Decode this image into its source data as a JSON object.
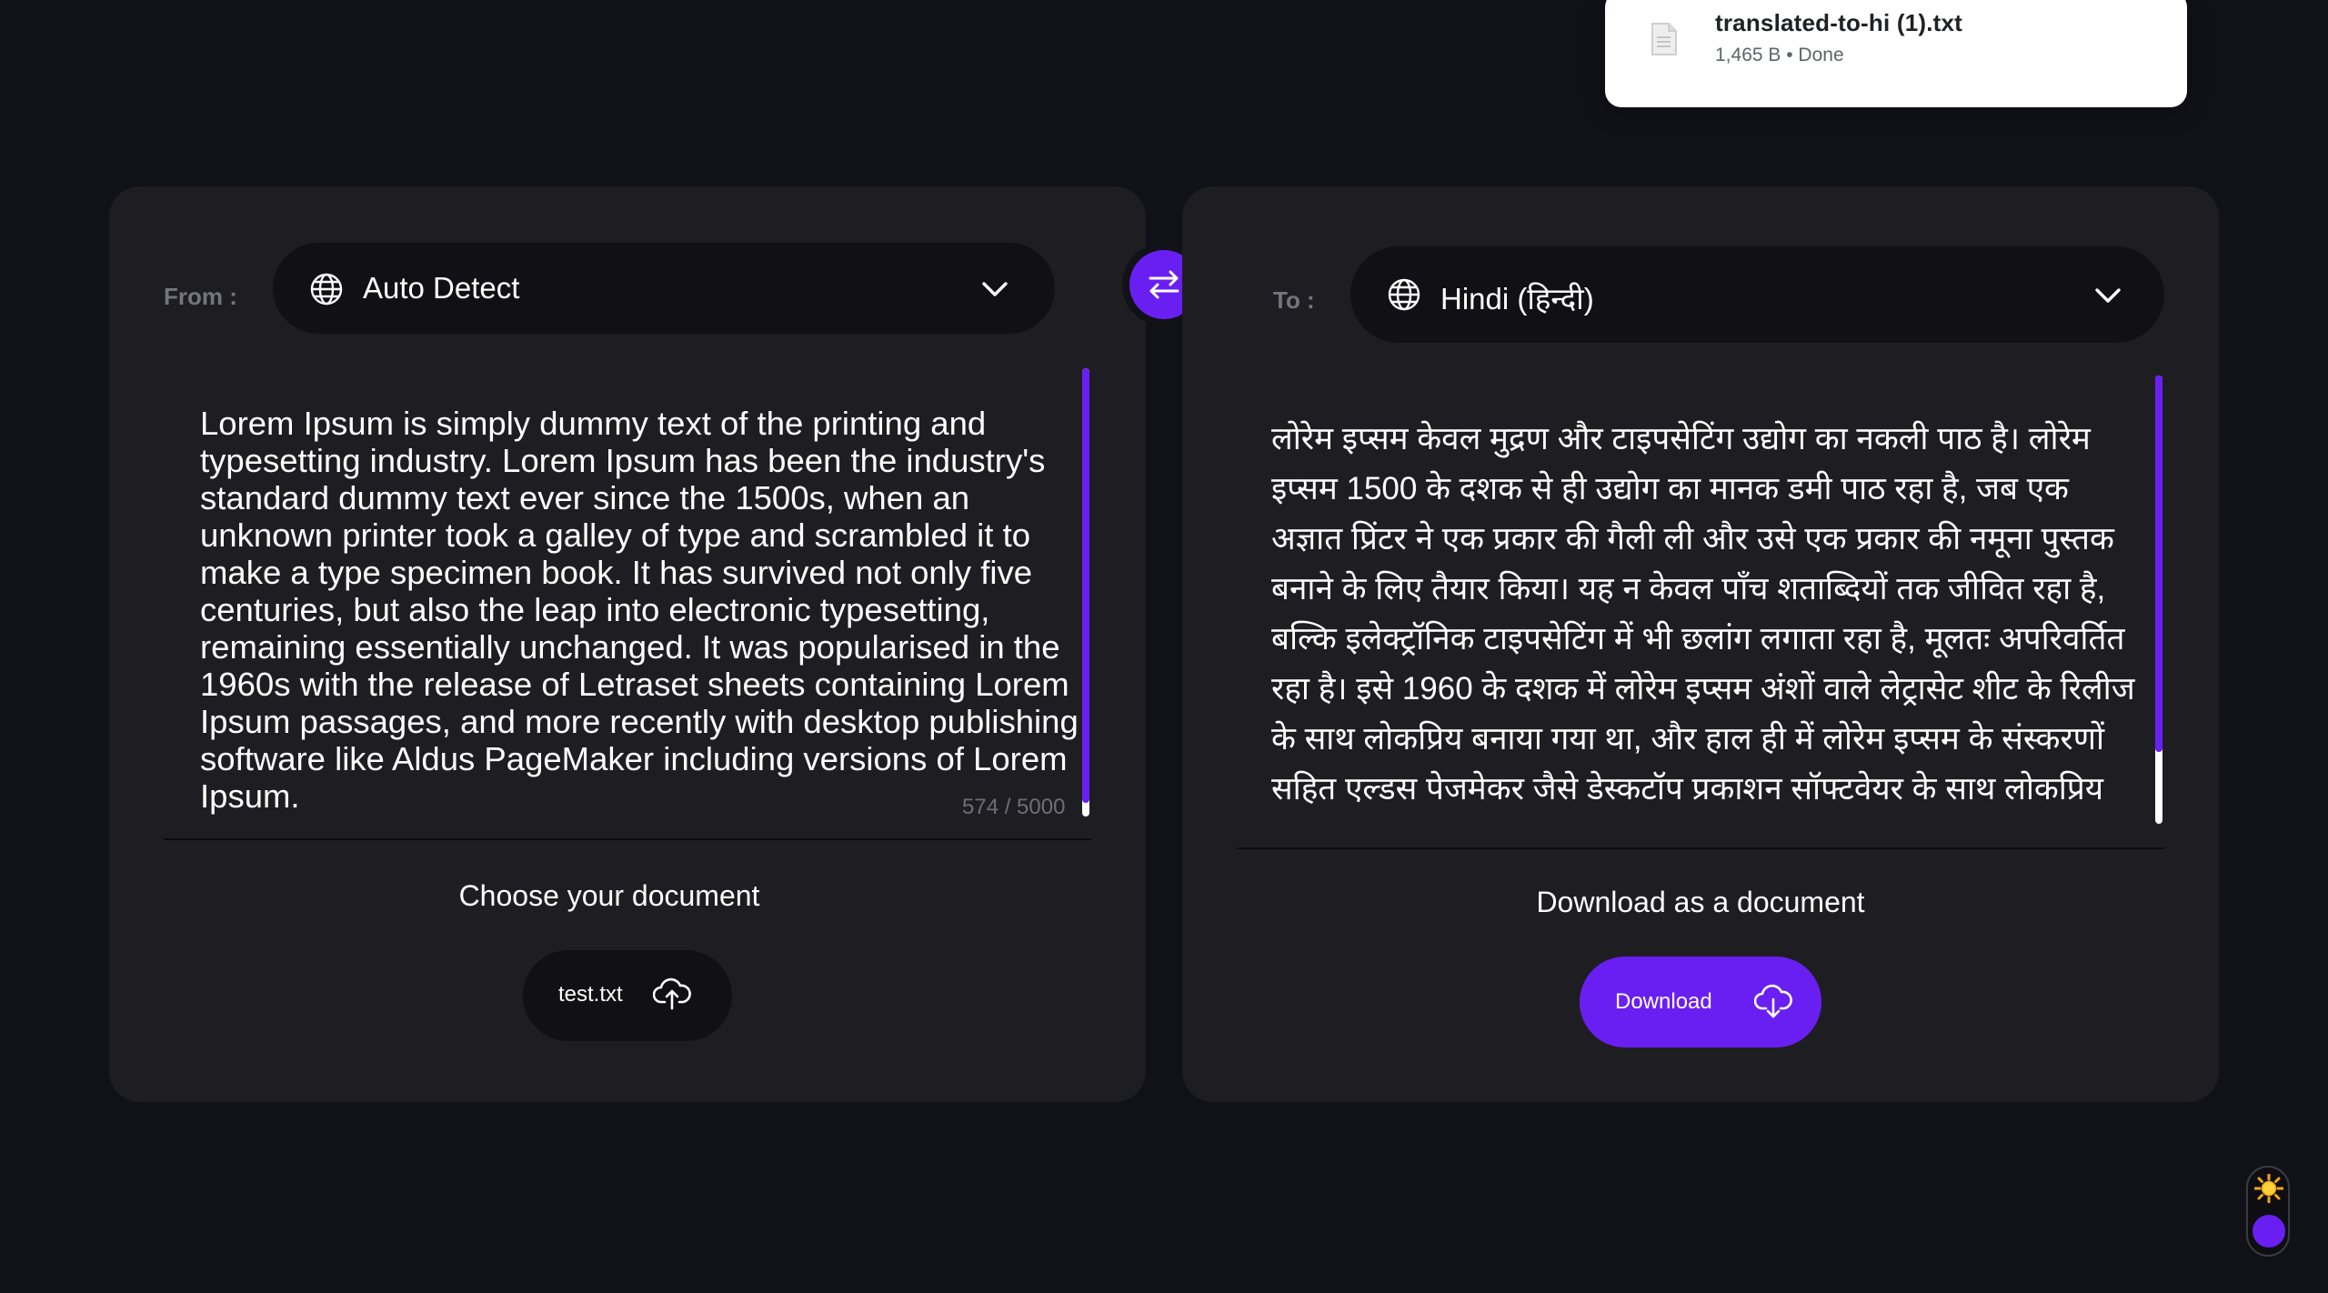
{
  "download_popup": {
    "file_name": "translated-to-hi (1).txt",
    "file_meta": "1,465 B • Done"
  },
  "source": {
    "label": "From :",
    "language": "Auto Detect",
    "text": "Lorem Ipsum is simply dummy text of the printing and typesetting industry. Lorem Ipsum has been the industry's standard dummy text ever since the 1500s, when an unknown printer took a galley of type and scrambled it to make a type specimen book. It has survived not only five centuries, but also the leap into electronic typesetting, remaining essentially unchanged. It was popularised in the 1960s with the release of Letraset sheets containing Lorem Ipsum passages, and more recently with desktop publishing software like Aldus PageMaker including versions of Lorem Ipsum.",
    "char_count": "574 / 5000",
    "scroll_position": 0.97,
    "document_caption": "Choose your document",
    "file_button_label": "test.txt"
  },
  "target": {
    "label": "To :",
    "language": "Hindi (हिन्दी)",
    "text": "लोरेम इप्सम केवल मुद्रण और टाइपसेटिंग उद्योग का नकली पाठ है। लोरेम इप्सम 1500 के दशक से ही उद्योग का मानक डमी पाठ रहा है, जब एक अज्ञात प्रिंटर ने एक प्रकार की गैली ली और उसे एक प्रकार की नमूना पुस्तक बनाने के लिए तैयार किया। यह न केवल पाँच शताब्दियों तक जीवित रहा है, बल्कि इलेक्ट्रॉनिक टाइपसेटिंग में भी छलांग लगाता रहा है, मूलतः अपरिवर्तित रहा है। इसे 1960 के दशक में लोरेम इप्सम अंशों वाले लेट्रासेट शीट के रिलीज के साथ लोकप्रिय बनाया गया था, और हाल ही में लोरेम इप्सम के संस्करणों सहित एल्डस पेजमेकर जैसे डेस्कटॉप प्रकाशन सॉफ्टवेयर के साथ लोकप्रिय हुआ।",
    "scroll_position": 0.84,
    "document_caption": "Download as a document",
    "download_button_label": "Download"
  },
  "icons": {
    "file": "file-icon",
    "globe": "globe-icon",
    "chevron": "chevron-down-icon",
    "swap": "swap-arrows-icon",
    "upload": "cloud-upload-icon",
    "download": "cloud-download-icon",
    "theme": "sun-icon"
  },
  "colors": {
    "background": "#111118",
    "panel": "#1e1e22",
    "accent": "#6a1ff2",
    "select_bg": "#111115"
  }
}
